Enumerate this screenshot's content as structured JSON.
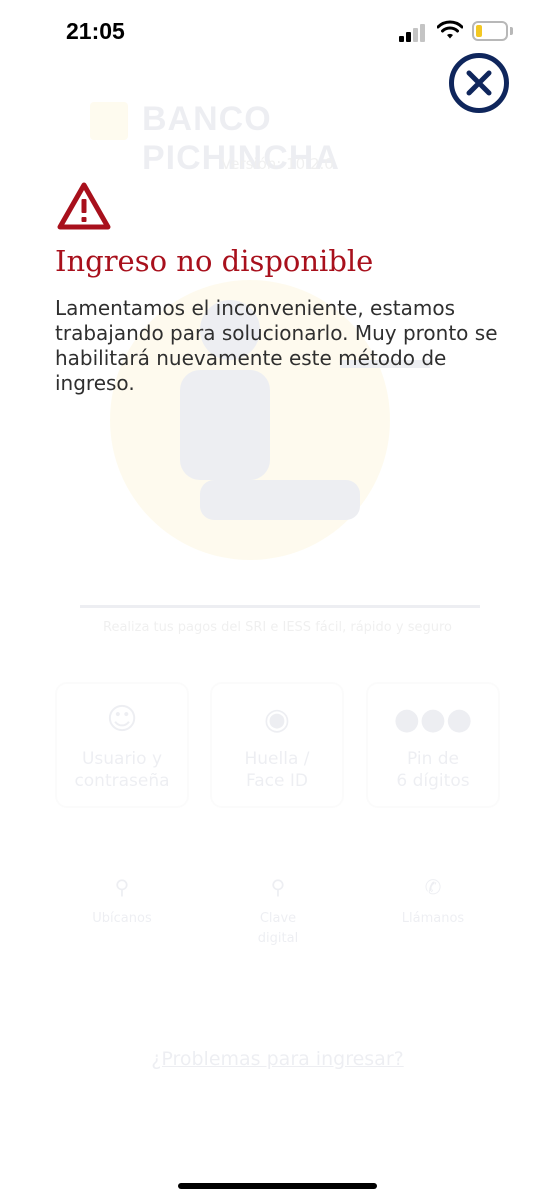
{
  "status_bar": {
    "time": "21:05",
    "battery_level": 0.22
  },
  "background": {
    "bank_name": "BANCO PICHINCHA",
    "version": "Versión: 10.2.0",
    "caption": "Realiza tus pagos del SRI e IESS fácil, rápido y seguro",
    "login_options": [
      {
        "line1": "Usuario y",
        "line2": "contraseña",
        "icon": "user-icon"
      },
      {
        "line1": "Huella /",
        "line2": "Face ID",
        "icon": "fingerprint-icon"
      },
      {
        "line1": "Pin de",
        "line2": "6 dígitos",
        "icon": "pin-dots-icon"
      }
    ],
    "quick_links": [
      {
        "line1": "Ubícanos",
        "line2": "",
        "icon": "location-icon"
      },
      {
        "line1": "Clave",
        "line2": "digital",
        "icon": "key-icon"
      },
      {
        "line1": "Llámanos",
        "line2": "",
        "icon": "phone-icon"
      }
    ],
    "help_link": "¿Problemas para ingresar?"
  },
  "alert": {
    "title": "Ingreso no disponible",
    "message": "Lamentamos el inconveniente, estamos trabajando para solucionarlo. Muy pronto se habilitará nuevamente este método de ingreso.",
    "icon": "warning-icon",
    "title_color": "#a8101c"
  },
  "close_button": {
    "icon": "close-icon",
    "color": "#0f265c"
  }
}
